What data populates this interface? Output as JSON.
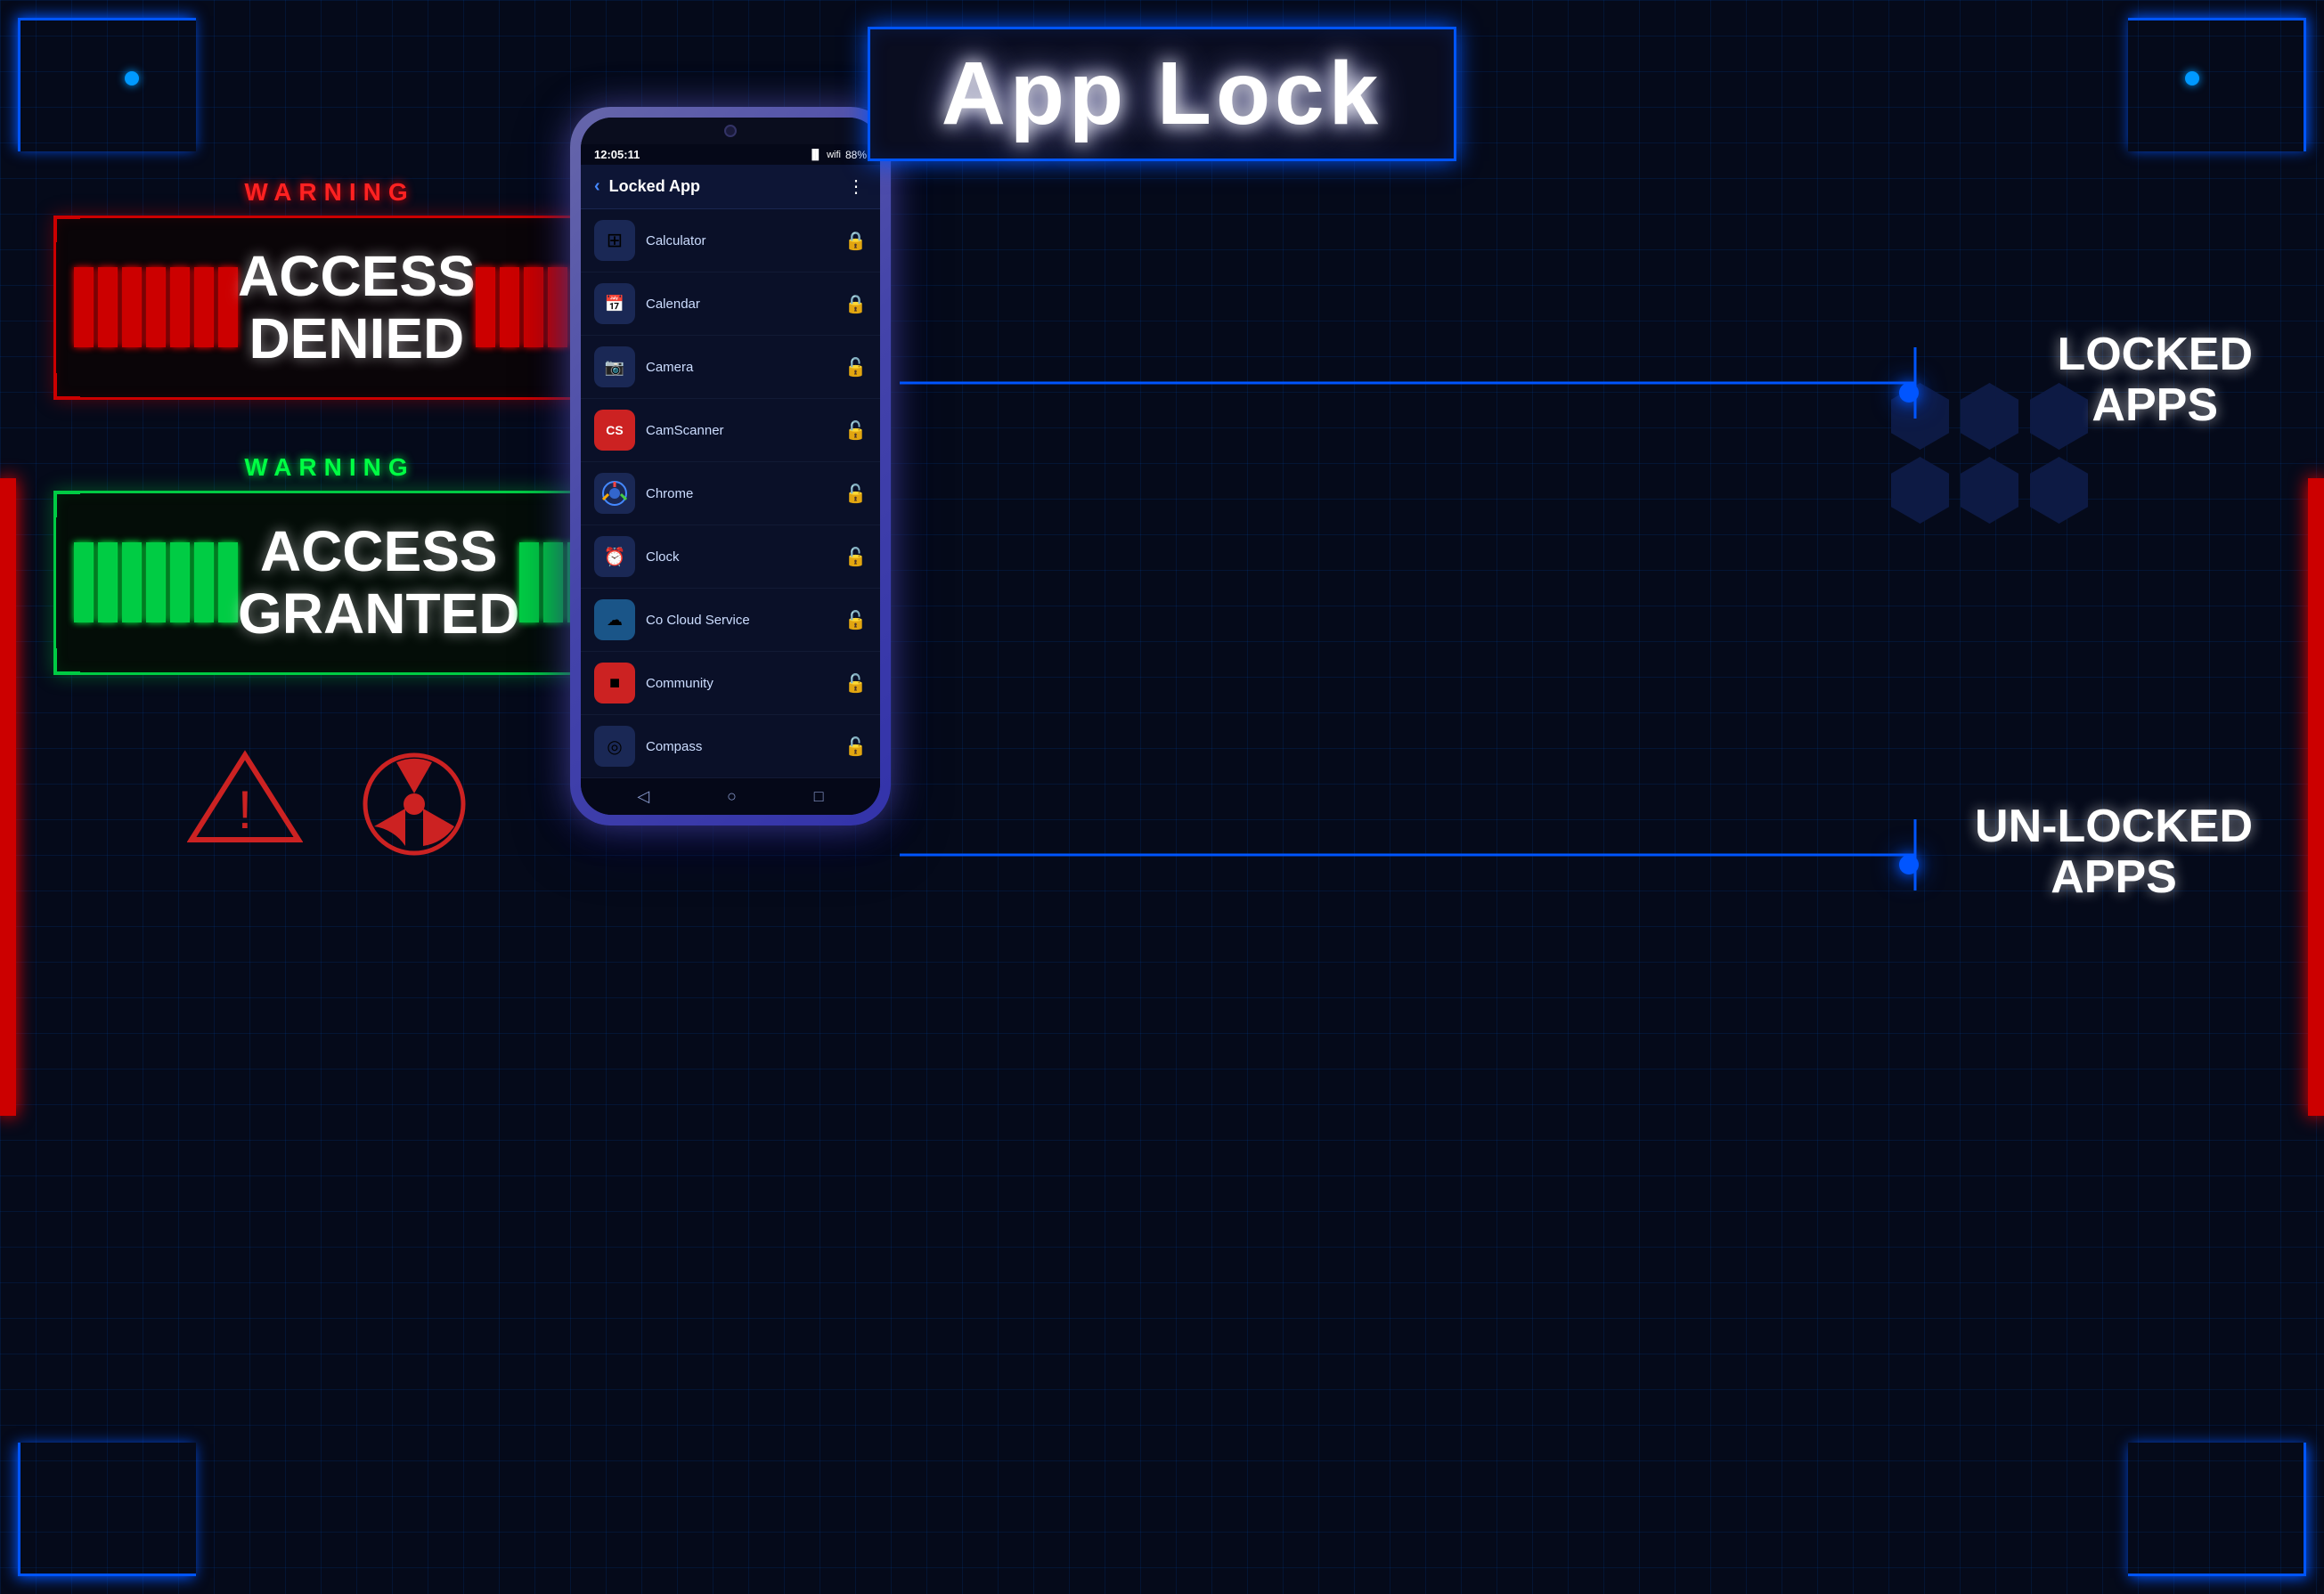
{
  "title": "App Lock",
  "warning": "WARNING",
  "access_denied": "ACCESS\nDENIED",
  "access_denied_line1": "ACCESS",
  "access_denied_line2": "DENIED",
  "access_granted_line1": "ACCESS",
  "access_granted_line2": "GRANTED",
  "locked_apps_label_line1": "LOCKED",
  "locked_apps_label_line2": "APPS",
  "unlocked_apps_label_line1": "UN-LOCKED",
  "unlocked_apps_label_line2": "APPS",
  "phone": {
    "status_time": "12:05:11",
    "battery": "88%",
    "screen_title": "Locked App",
    "apps": [
      {
        "name": "Calculator",
        "icon": "⊞",
        "icon_bg": "#1a2855",
        "locked": true
      },
      {
        "name": "Calendar",
        "icon": "📅",
        "icon_bg": "#1a2855",
        "locked": true
      },
      {
        "name": "Camera",
        "icon": "📷",
        "icon_bg": "#1a2855",
        "locked": false
      },
      {
        "name": "CamScanner",
        "icon": "CS",
        "icon_bg": "#cc2222",
        "locked": false
      },
      {
        "name": "Chrome",
        "icon": "◉",
        "icon_bg": "#1a2855",
        "locked": false
      },
      {
        "name": "Clock",
        "icon": "⏰",
        "icon_bg": "#1a2855",
        "locked": false
      },
      {
        "name": "Co Cloud Service",
        "icon": "☁",
        "icon_bg": "#1a5588",
        "locked": false
      },
      {
        "name": "Community",
        "icon": "■",
        "icon_bg": "#cc2222",
        "locked": false
      },
      {
        "name": "Compass",
        "icon": "◎",
        "icon_bg": "#1a2855",
        "locked": false
      }
    ]
  }
}
